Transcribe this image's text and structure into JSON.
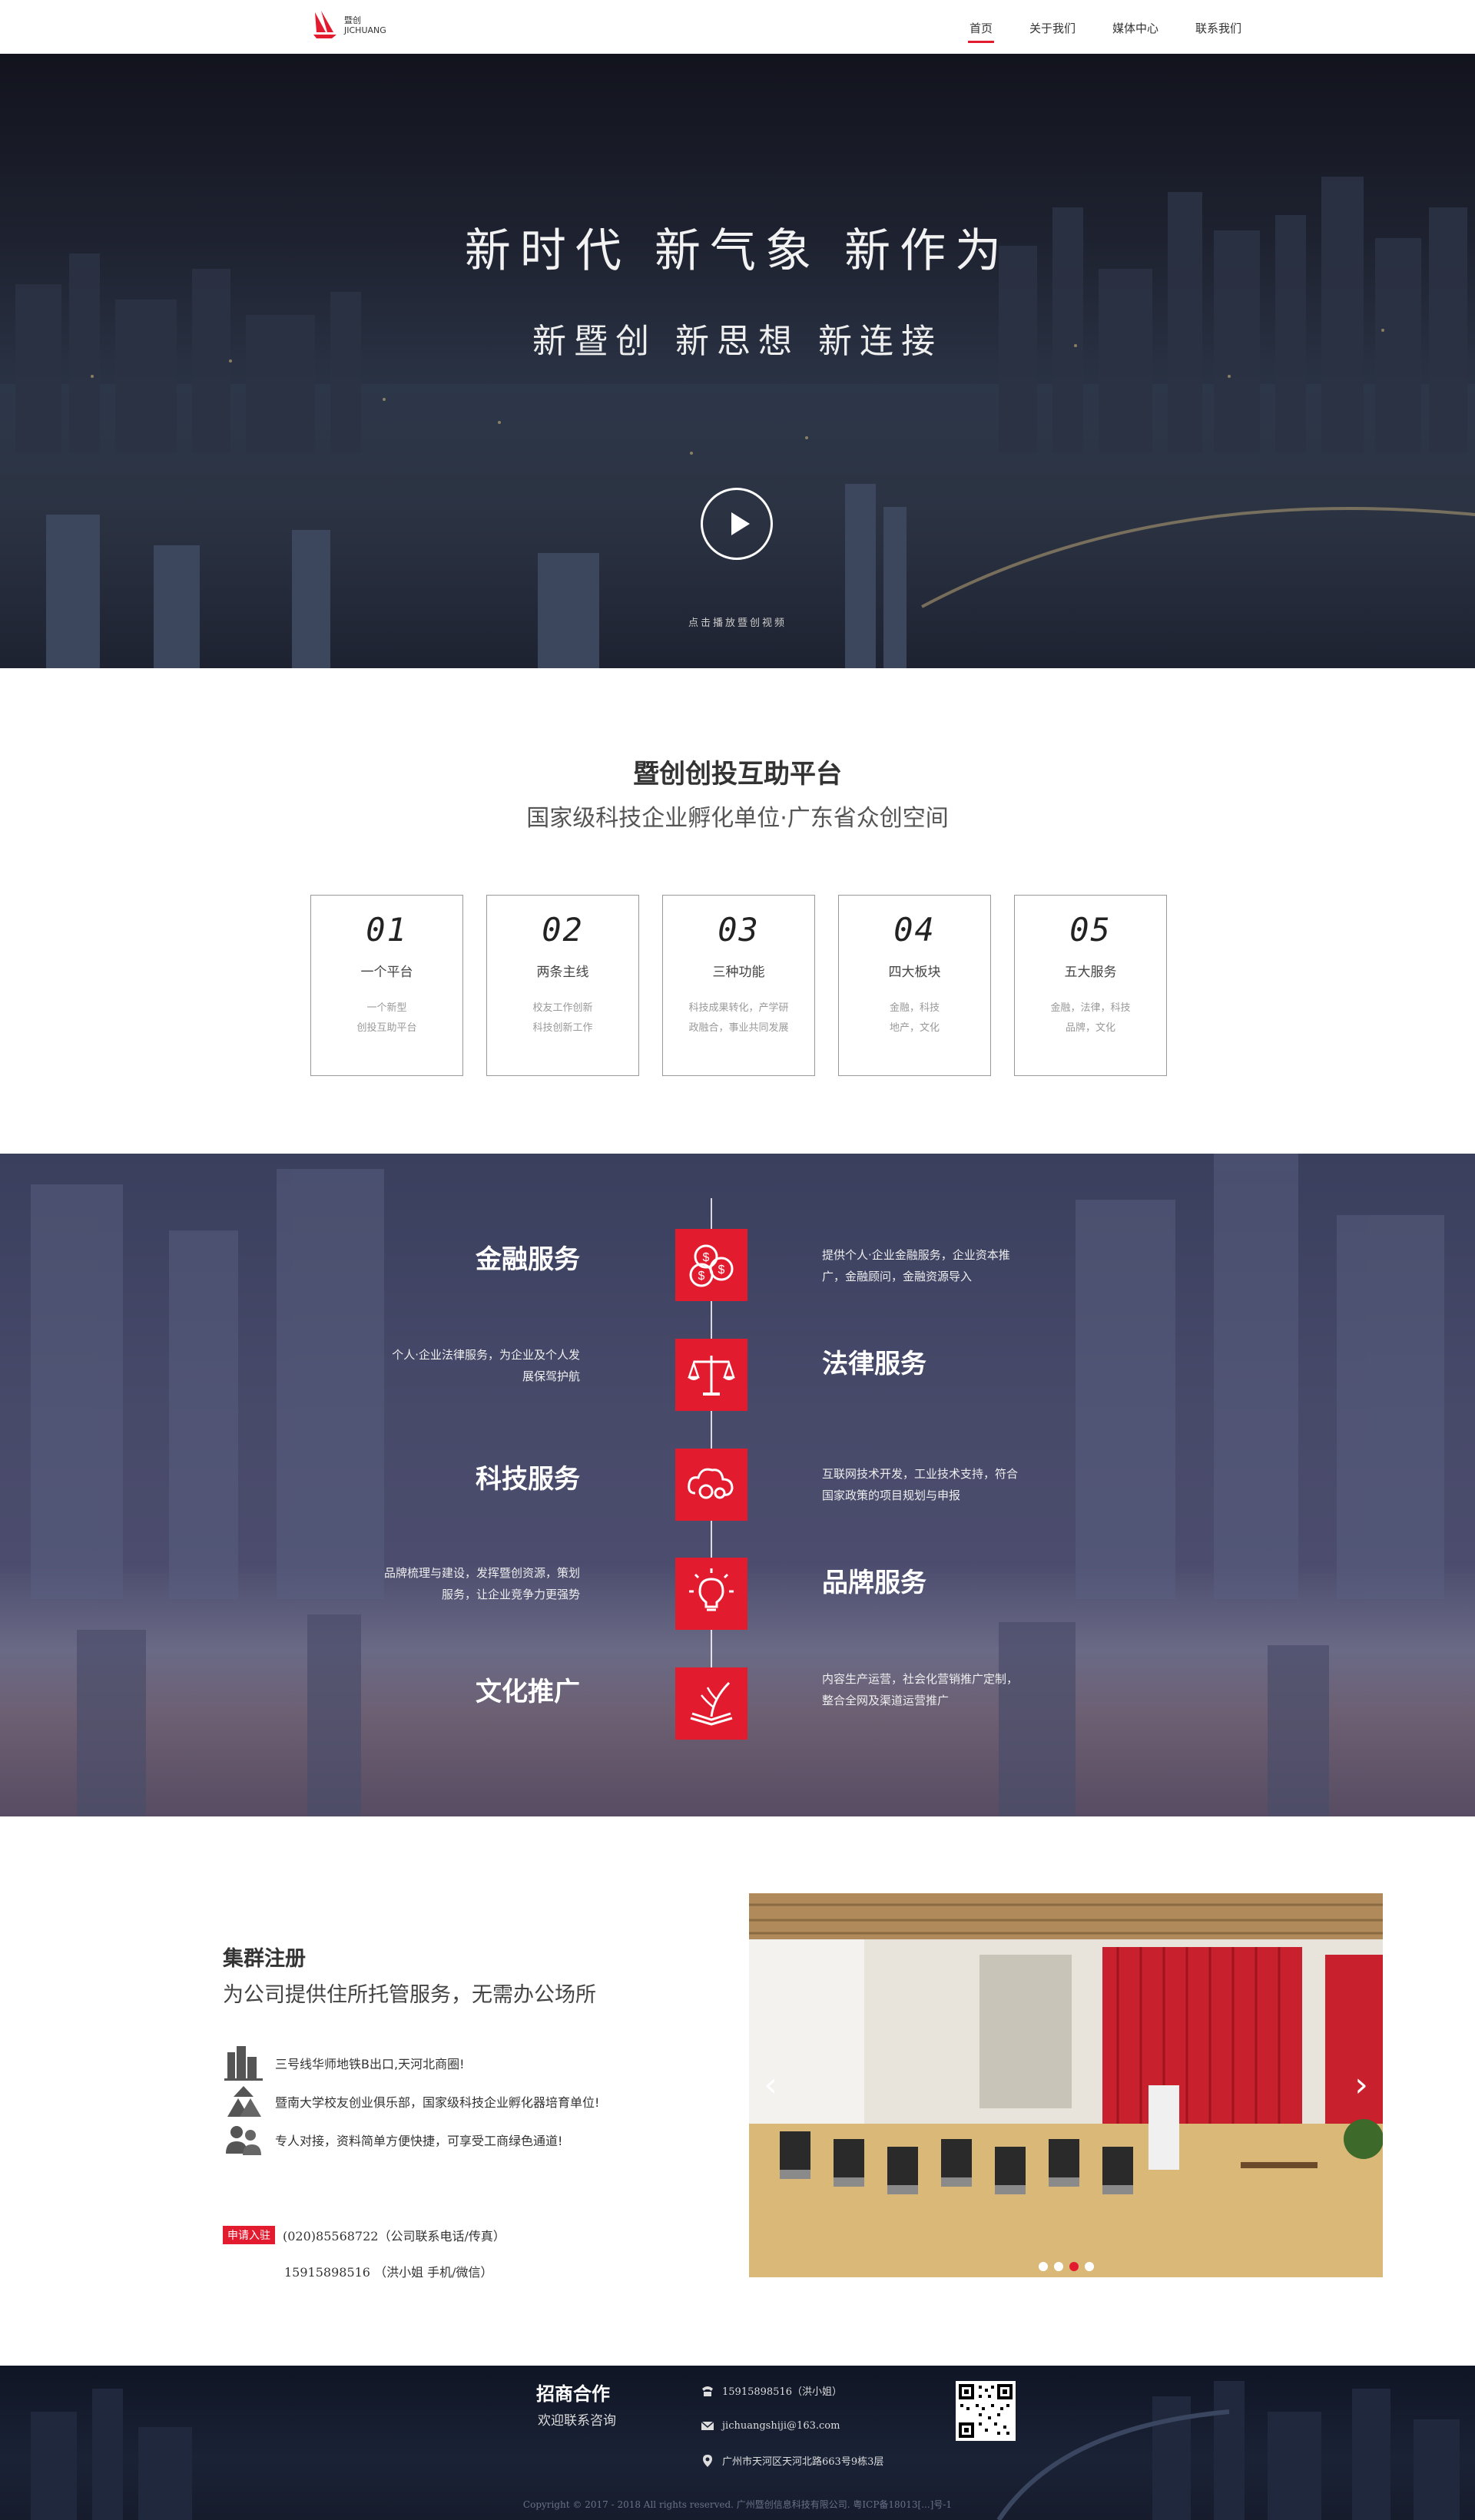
{
  "nav": {
    "logo_cn": "暨创",
    "logo_en": "JICHUANG",
    "items": [
      {
        "label": "首页",
        "active": true
      },
      {
        "label": "关于我们",
        "active": false
      },
      {
        "label": "媒体中心",
        "active": false
      },
      {
        "label": "联系我们",
        "active": false
      }
    ]
  },
  "hero": {
    "title": "新时代 新气象 新作为",
    "subtitle": "新暨创 新思想 新连接",
    "play_caption": "点击播放暨创视频"
  },
  "platform": {
    "title": "暨创创投互助平台",
    "subtitle": "国家级科技企业孵化单位·广东省众创空间",
    "cards": [
      {
        "num": "01",
        "title": "一个平台",
        "desc1": "一个新型",
        "desc2": "创投互助平台"
      },
      {
        "num": "02",
        "title": "两条主线",
        "desc1": "校友工作创新",
        "desc2": "科技创新工作"
      },
      {
        "num": "03",
        "title": "三种功能",
        "desc1": "科技成果转化，产学研",
        "desc2": "政融合，事业共同发展"
      },
      {
        "num": "04",
        "title": "四大板块",
        "desc1": "金融，科技",
        "desc2": "地产，文化"
      },
      {
        "num": "05",
        "title": "五大服务",
        "desc1": "金融，法律，科技",
        "desc2": "品牌，文化"
      }
    ]
  },
  "services": [
    {
      "title": "金融服务",
      "desc1": "提供个人·企业金融服务，企业资本推",
      "desc2": "广，金融顾问，金融资源导入",
      "icon": "coins-icon"
    },
    {
      "title": "法律服务",
      "desc1": "个人·企业法律服务，为企业及个人发",
      "desc2": "展保驾护航",
      "icon": "scales-icon"
    },
    {
      "title": "科技服务",
      "desc1": "互联网技术开发，工业技术支持，符合",
      "desc2": "国家政策的项目规划与申报",
      "icon": "cloud-tech-icon"
    },
    {
      "title": "品牌服务",
      "desc1": "品牌梳理与建设，发挥暨创资源，策划",
      "desc2": "服务，让企业竞争力更强势",
      "icon": "lightbulb-icon"
    },
    {
      "title": "文化推广",
      "desc1": "内容生产运营，社会化营销推广定制，",
      "desc2": "整合全网及渠道运营推广",
      "icon": "book-icon"
    }
  ],
  "cluster": {
    "title": "集群注册",
    "subtitle": "为公司提供住所托管服务，无需办公场所",
    "items": [
      {
        "text": "三号线华师地铁B出口,天河北商圈!",
        "icon": "building-icon"
      },
      {
        "text": "暨南大学校友创业俱乐部，国家级科技企业孵化器培育单位!",
        "icon": "mountain-icon"
      },
      {
        "text": "专人对接，资料简单方便快捷，可享受工商绿色通道!",
        "icon": "people-icon"
      }
    ],
    "apply_label": "申请入驻",
    "phone1": "(020)85568722（公司联系电话/传真）",
    "phone2": "15915898516 （洪小姐 手机/微信）",
    "carousel": {
      "slides": 4,
      "active_index": 2
    }
  },
  "footer": {
    "title": "招商合作",
    "subtitle": "欢迎联系咨询",
    "phone": "15915898516（洪小姐）",
    "email": "jichuangshiji@163.com",
    "address": "广州市天河区天河北路663号9栋3层",
    "copyright": "Copyright © 2017 - 2018 All rights reserved. 广州暨创信息科技有限公司. 粤ICP备18013[...]号-1"
  },
  "colors": {
    "accent": "#e31b2f"
  }
}
